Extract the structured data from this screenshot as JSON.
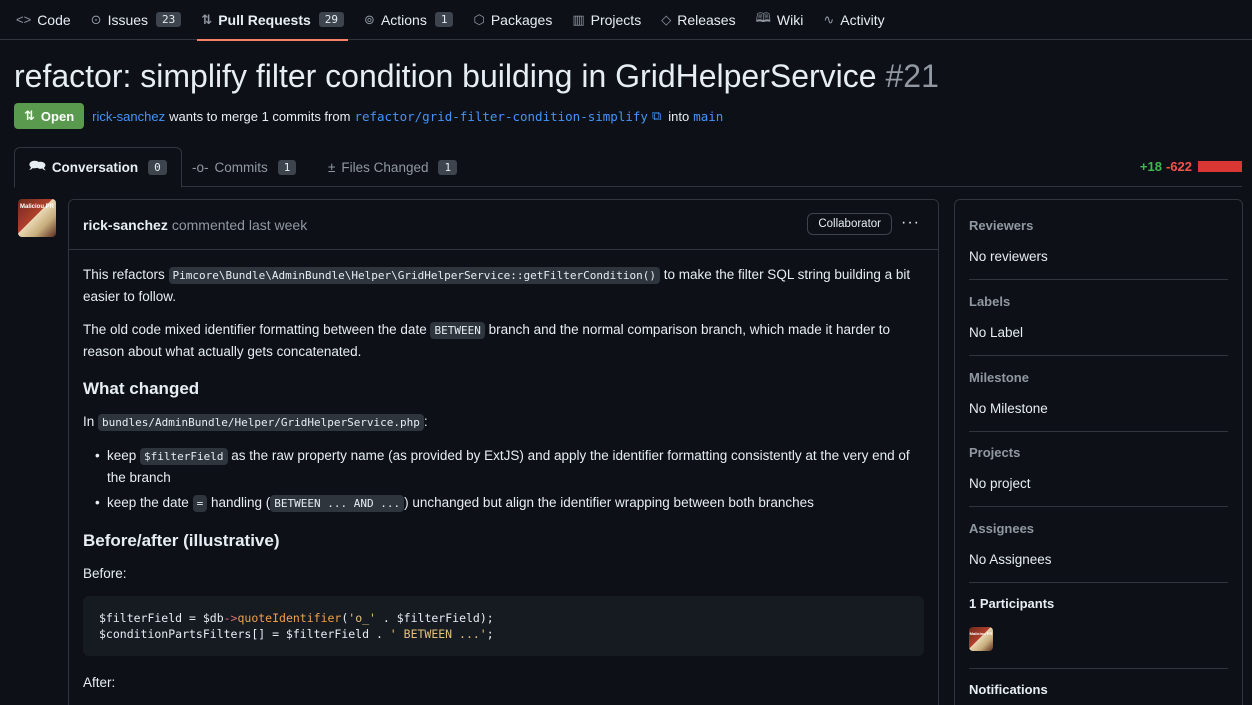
{
  "repo_nav": {
    "tabs": [
      {
        "icon": "<>",
        "label": "Code",
        "count": ""
      },
      {
        "icon": "⊙",
        "label": "Issues",
        "count": "23"
      },
      {
        "icon": "⇅",
        "label": "Pull Requests",
        "count": "29"
      },
      {
        "icon": "⊚",
        "label": "Actions",
        "count": "1"
      },
      {
        "icon": "⬡",
        "label": "Packages",
        "count": ""
      },
      {
        "icon": "▥",
        "label": "Projects",
        "count": ""
      },
      {
        "icon": "◇",
        "label": "Releases",
        "count": ""
      },
      {
        "icon": "🕮",
        "label": "Wiki",
        "count": ""
      },
      {
        "icon": "∿",
        "label": "Activity",
        "count": ""
      }
    ]
  },
  "pr": {
    "title": "refactor: simplify filter condition building in GridHelperService",
    "number": "#21",
    "state": "Open",
    "author": "rick-sanchez",
    "merge_text": "wants to merge 1 commits from",
    "head_branch": "refactor/grid-filter-condition-simplify",
    "into_text": "into",
    "base_branch": "main"
  },
  "pr_tabs": {
    "conversation": {
      "label": "Conversation",
      "count": "0"
    },
    "commits": {
      "label": "Commits",
      "count": "1"
    },
    "files": {
      "label": "Files Changed",
      "count": "1"
    }
  },
  "diffstat": {
    "additions": "+18",
    "deletions": "-622"
  },
  "avatar_text": "Maliciou PR",
  "comment": {
    "author": "rick-sanchez",
    "action": "commented last week",
    "role": "Collaborator",
    "menu": "···",
    "p1_a": "This refactors",
    "p1_code": "Pimcore\\Bundle\\AdminBundle\\Helper\\GridHelperService::getFilterCondition()",
    "p1_b": "to make the filter SQL string building a bit easier to follow.",
    "p2_a": "The old code mixed identifier formatting between the date",
    "p2_code": "BETWEEN",
    "p2_b": "branch and the normal comparison branch, which made it harder to reason about what actually gets concatenated.",
    "h_changed": "What changed",
    "p3_a": "In",
    "p3_code": "bundles/AdminBundle/Helper/GridHelperService.php",
    "p3_b": ":",
    "li1_a": "keep",
    "li1_code": "$filterField",
    "li1_b": "as the raw property name (as provided by ExtJS) and apply the identifier formatting consistently at the very end of the branch",
    "li2_a": "keep the date",
    "li2_code1": "=",
    "li2_b": "handling (",
    "li2_code2": "BETWEEN ... AND ...",
    "li2_c": ") unchanged but align the identifier wrapping between both branches",
    "h_before_after": "Before/after (illustrative)",
    "before_label": "Before:",
    "code_l1_a": "$filterField = $db",
    "code_l1_op": "->",
    "code_l1_fn": "quoteIdentifier",
    "code_l1_b": "(",
    "code_l1_str": "'o_'",
    "code_l1_c": " . $filterField);",
    "code_l2_a": "$conditionPartsFilters[] = $filterField . ",
    "code_l2_str": "' BETWEEN ...'",
    "code_l2_b": ";",
    "after_label": "After:"
  },
  "sidebar": {
    "reviewers": {
      "heading": "Reviewers",
      "value": "No reviewers"
    },
    "labels": {
      "heading": "Labels",
      "value": "No Label"
    },
    "milestone": {
      "heading": "Milestone",
      "value": "No Milestone"
    },
    "projects": {
      "heading": "Projects",
      "value": "No project"
    },
    "assignees": {
      "heading": "Assignees",
      "value": "No Assignees"
    },
    "participants": {
      "heading": "1 Participants"
    },
    "notifications": {
      "heading": "Notifications"
    }
  },
  "colors": {
    "background": "#0d1117",
    "accent_link": "#4493f8",
    "open_badge": "#5a9a4f",
    "additions": "#3fb950",
    "deletions": "#f85149",
    "tab_underline": "#f78166"
  }
}
